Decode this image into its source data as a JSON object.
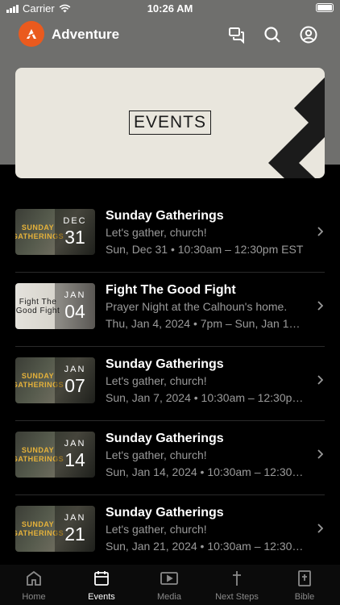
{
  "status_bar": {
    "carrier": "Carrier",
    "time": "10:26 AM"
  },
  "header": {
    "title": "Adventure",
    "icons": [
      "chat-icon",
      "search-icon",
      "profile-icon"
    ]
  },
  "banner": {
    "label": "EVENTS"
  },
  "events": [
    {
      "month": "DEC",
      "day": "31",
      "title": "Sunday Gatherings",
      "subtitle": "Let's gather, church!",
      "when": "Sun, Dec 31 • 10:30am – 12:30pm EST",
      "thumb": "sunday"
    },
    {
      "month": "JAN",
      "day": "04",
      "title": "Fight The Good Fight",
      "subtitle": "Prayer Night at the Calhoun's home.",
      "when": "Thu, Jan 4, 2024 • 7pm – Sun, Jan 1…",
      "thumb": "fight",
      "thumb_text": [
        "Fight The",
        "Good Fight"
      ]
    },
    {
      "month": "JAN",
      "day": "07",
      "title": "Sunday Gatherings",
      "subtitle": "Let's gather, church!",
      "when": "Sun, Jan 7, 2024 • 10:30am – 12:30p…",
      "thumb": "sunday"
    },
    {
      "month": "JAN",
      "day": "14",
      "title": "Sunday Gatherings",
      "subtitle": "Let's gather, church!",
      "when": "Sun, Jan 14, 2024 • 10:30am – 12:30…",
      "thumb": "sunday"
    },
    {
      "month": "JAN",
      "day": "21",
      "title": "Sunday Gatherings",
      "subtitle": "Let's gather, church!",
      "when": "Sun, Jan 21, 2024 • 10:30am – 12:30…",
      "thumb": "sunday"
    }
  ],
  "sunday_thumb_text": [
    "SUNDAY",
    "GATHERINGS"
  ],
  "tabs": [
    {
      "label": "Home",
      "icon": "home-icon",
      "active": false
    },
    {
      "label": "Events",
      "icon": "calendar-icon",
      "active": true
    },
    {
      "label": "Media",
      "icon": "play-icon",
      "active": false
    },
    {
      "label": "Next Steps",
      "icon": "cross-icon",
      "active": false
    },
    {
      "label": "Bible",
      "icon": "bible-icon",
      "active": false
    }
  ],
  "colors": {
    "accent": "#ea5a1e",
    "header_bg": "#6f6f6d",
    "banner_bg": "#e9e6dd",
    "muted": "#9a9a9a"
  }
}
